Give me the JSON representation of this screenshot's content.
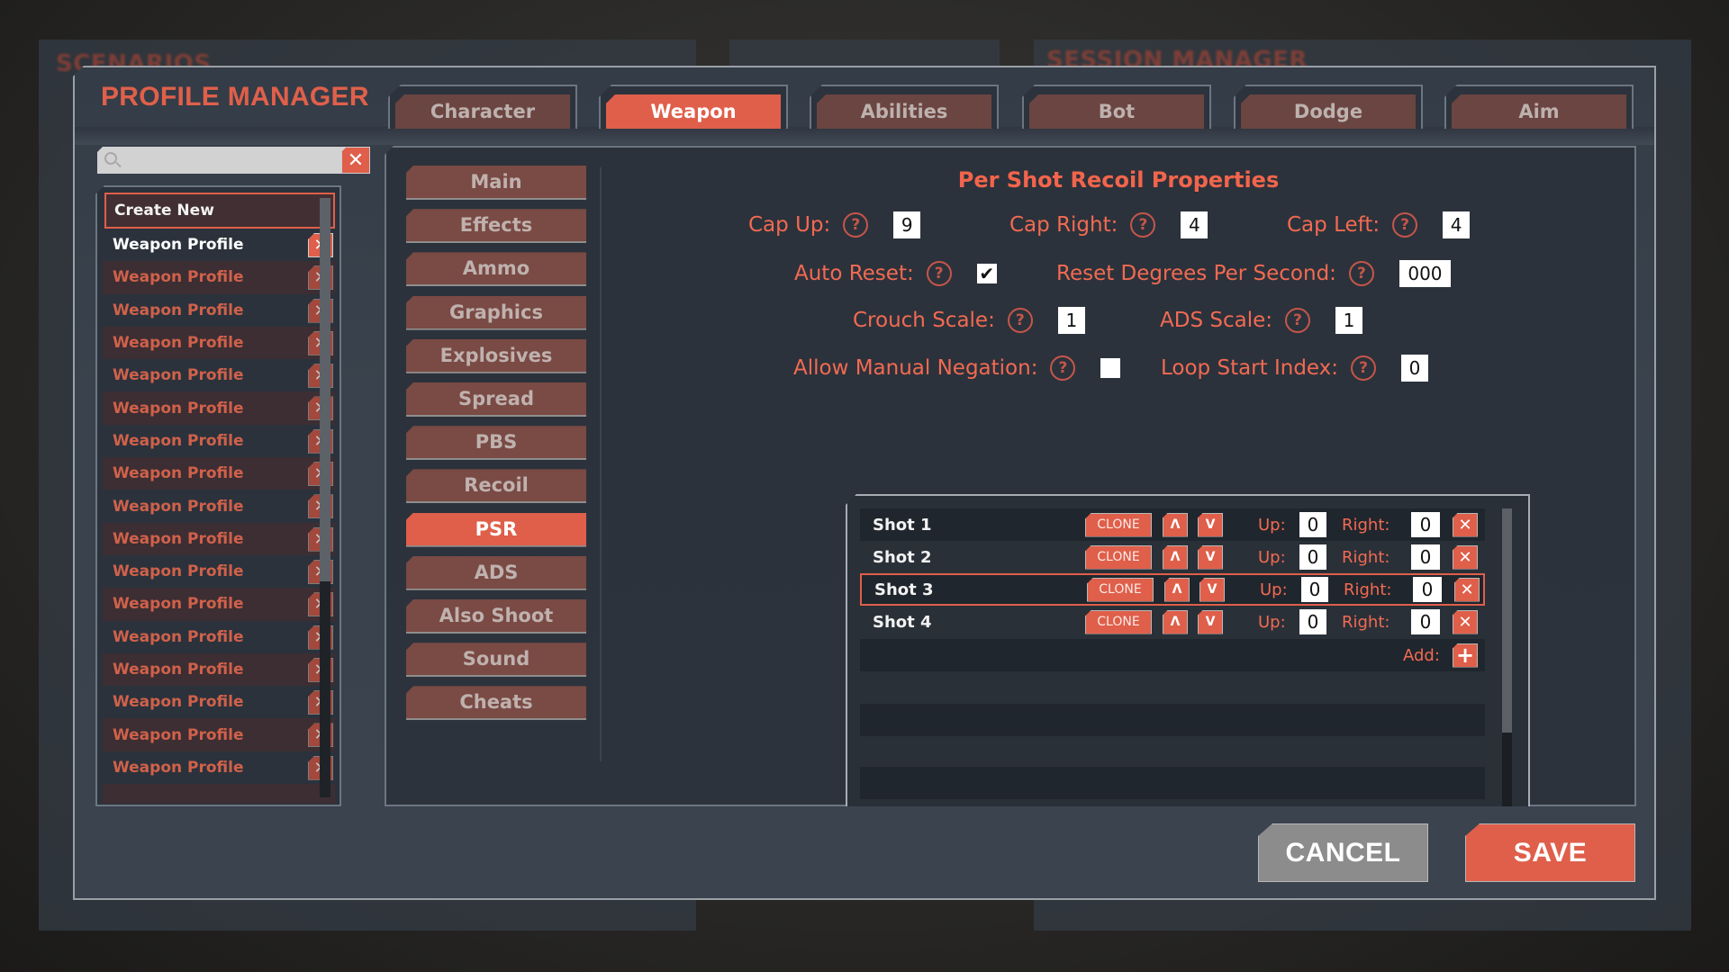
{
  "background": {
    "left_panel_title": "SCENARIOS",
    "right_panel_title": "SESSION MANAGER"
  },
  "modal": {
    "title": "PROFILE MANAGER",
    "tabs": [
      {
        "label": "Character",
        "active": false
      },
      {
        "label": "Weapon",
        "active": true
      },
      {
        "label": "Abilities",
        "active": false
      },
      {
        "label": "Bot",
        "active": false
      },
      {
        "label": "Dodge",
        "active": false
      },
      {
        "label": "Aim",
        "active": false
      }
    ]
  },
  "search": {
    "value": "",
    "placeholder": "",
    "icon": "search-icon",
    "clear_icon": "close-icon",
    "clear_glyph": "✕"
  },
  "profiles": {
    "create_new_label": "Create New",
    "delete_glyph": "✕",
    "items": [
      {
        "label": "Weapon Profile",
        "selected": true
      },
      {
        "label": "Weapon Profile",
        "selected": false
      },
      {
        "label": "Weapon Profile",
        "selected": false
      },
      {
        "label": "Weapon Profile",
        "selected": false
      },
      {
        "label": "Weapon Profile",
        "selected": false
      },
      {
        "label": "Weapon Profile",
        "selected": false
      },
      {
        "label": "Weapon Profile",
        "selected": false
      },
      {
        "label": "Weapon Profile",
        "selected": false
      },
      {
        "label": "Weapon Profile",
        "selected": false
      },
      {
        "label": "Weapon Profile",
        "selected": false
      },
      {
        "label": "Weapon Profile",
        "selected": false
      },
      {
        "label": "Weapon Profile",
        "selected": false
      },
      {
        "label": "Weapon Profile",
        "selected": false
      },
      {
        "label": "Weapon Profile",
        "selected": false
      },
      {
        "label": "Weapon Profile",
        "selected": false
      },
      {
        "label": "Weapon Profile",
        "selected": false
      },
      {
        "label": "Weapon Profile",
        "selected": false
      }
    ],
    "scroll_fraction_visible": 0.64
  },
  "weapon_nav": {
    "items": [
      {
        "label": "Main",
        "active": false
      },
      {
        "label": "Effects",
        "active": false
      },
      {
        "label": "Ammo",
        "active": false
      },
      {
        "label": "Graphics",
        "active": false
      },
      {
        "label": "Explosives",
        "active": false
      },
      {
        "label": "Spread",
        "active": false
      },
      {
        "label": "PBS",
        "active": false
      },
      {
        "label": "Recoil",
        "active": false
      },
      {
        "label": "PSR",
        "active": true
      },
      {
        "label": "ADS",
        "active": false
      },
      {
        "label": "Also Shoot",
        "active": false
      },
      {
        "label": "Sound",
        "active": false
      },
      {
        "label": "Cheats",
        "active": false
      }
    ]
  },
  "psr": {
    "title": "Per Shot Recoil Properties",
    "help_glyph": "?",
    "cap_up": {
      "label": "Cap Up:",
      "value": "9"
    },
    "cap_right": {
      "label": "Cap Right:",
      "value": "4"
    },
    "cap_left": {
      "label": "Cap Left:",
      "value": "4"
    },
    "auto_reset": {
      "label": "Auto Reset:",
      "checked": true,
      "check_glyph": "✔"
    },
    "reset_degrees": {
      "label": "Reset Degrees Per Second:",
      "value": "000"
    },
    "crouch_scale": {
      "label": "Crouch Scale:",
      "value": "1"
    },
    "ads_scale": {
      "label": "ADS Scale:",
      "value": "1"
    },
    "allow_manual_negation": {
      "label": "Allow Manual Negation:",
      "checked": false
    },
    "loop_start_index": {
      "label": "Loop Start Index:",
      "value": "0"
    }
  },
  "shots": {
    "clone_label": "CLONE",
    "up_glyph": "Λ",
    "down_glyph": "V",
    "up_label": "Up:",
    "right_label": "Right:",
    "delete_glyph": "✕",
    "add_label": "Add:",
    "add_glyph": "+",
    "items": [
      {
        "name": "Shot 1",
        "up": "0",
        "right": "0",
        "selected": false
      },
      {
        "name": "Shot 2",
        "up": "0",
        "right": "0",
        "selected": false
      },
      {
        "name": "Shot 3",
        "up": "0",
        "right": "0",
        "selected": true
      },
      {
        "name": "Shot 4",
        "up": "0",
        "right": "0",
        "selected": false
      }
    ],
    "scroll_fraction_visible": 0.7
  },
  "footer": {
    "cancel_label": "CANCEL",
    "save_label": "SAVE"
  }
}
